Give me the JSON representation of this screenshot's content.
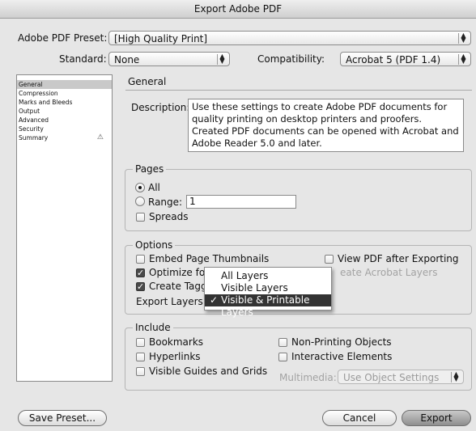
{
  "window": {
    "title": "Export Adobe PDF"
  },
  "preset": {
    "label": "Adobe PDF Preset:",
    "value": "[High Quality Print]"
  },
  "standard": {
    "label": "Standard:",
    "value": "None"
  },
  "compatibility": {
    "label": "Compatibility:",
    "value": "Acrobat 5 (PDF 1.4)"
  },
  "sidebar": {
    "items": [
      {
        "label": "General",
        "selected": true
      },
      {
        "label": "Compression"
      },
      {
        "label": "Marks and Bleeds"
      },
      {
        "label": "Output"
      },
      {
        "label": "Advanced"
      },
      {
        "label": "Security"
      },
      {
        "label": "Summary",
        "icon": "warning-icon"
      }
    ]
  },
  "panel": {
    "title": "General",
    "description_label": "Description:",
    "description_text": "Use these settings to create Adobe PDF documents for quality printing on desktop printers and proofers.  Created PDF documents can be opened with Acrobat and Adobe Reader 5.0 and later."
  },
  "pages": {
    "title": "Pages",
    "all_label": "All",
    "range_label": "Range:",
    "range_value": "1",
    "spreads_label": "Spreads"
  },
  "options": {
    "title": "Options",
    "embed_thumbnails": "Embed Page Thumbnails",
    "optimize": "Optimize for",
    "create_tagged": "Create Tagg",
    "view_pdf": "View PDF after Exporting",
    "create_layers": "eate Acrobat Layers",
    "export_layers_label": "Export Layers:"
  },
  "layers_menu": {
    "items": [
      {
        "label": "All Layers"
      },
      {
        "label": "Visible Layers"
      },
      {
        "label": "Visible & Printable Layers",
        "selected": true,
        "check": "✓"
      }
    ]
  },
  "include": {
    "title": "Include",
    "bookmarks": "Bookmarks",
    "hyperlinks": "Hyperlinks",
    "guides": "Visible Guides and Grids",
    "nonprinting": "Non-Printing Objects",
    "interactive": "Interactive Elements",
    "multimedia_label": "Multimedia:",
    "multimedia_value": "Use Object Settings"
  },
  "buttons": {
    "save_preset": "Save Preset...",
    "cancel": "Cancel",
    "export": "Export"
  }
}
